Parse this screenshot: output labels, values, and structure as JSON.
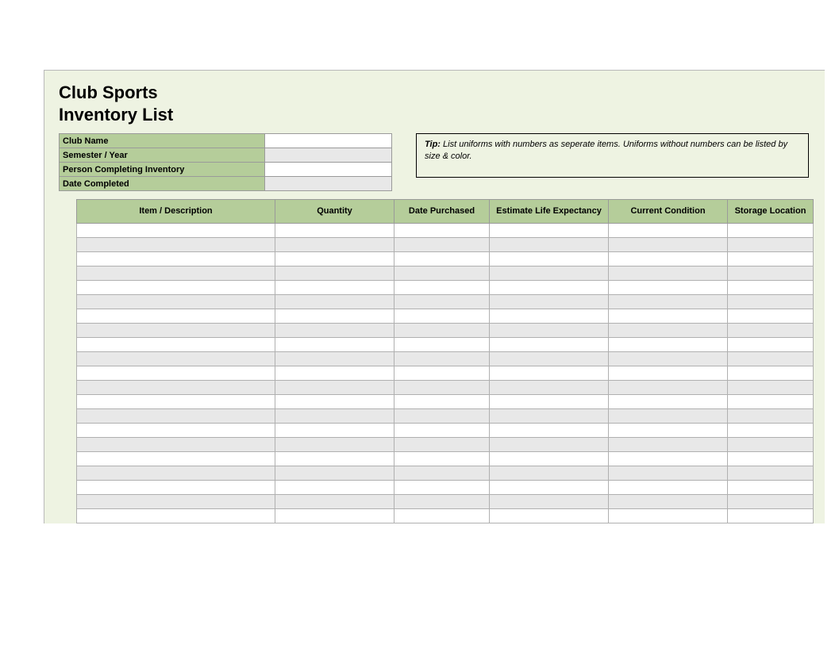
{
  "title_line1": "Club Sports",
  "title_line2": "Inventory List",
  "meta": {
    "fields": [
      {
        "label": "Club Name",
        "value": "",
        "alt": false
      },
      {
        "label": "Semester / Year",
        "value": "",
        "alt": true
      },
      {
        "label": "Person Completing Inventory",
        "value": "",
        "alt": false
      },
      {
        "label": "Date Completed",
        "value": "",
        "alt": true
      }
    ]
  },
  "tip": {
    "label": "Tip:",
    "text": " List uniforms with numbers as seperate items. Uniforms without numbers can be listed by size & color."
  },
  "inventory": {
    "headers": [
      "Item / Description",
      "Quantity",
      "Date Purchased",
      "Estimate Life Expectancy",
      "Current Condition",
      "Storage Location"
    ],
    "rows": [
      [
        "",
        "",
        "",
        "",
        "",
        ""
      ],
      [
        "",
        "",
        "",
        "",
        "",
        ""
      ],
      [
        "",
        "",
        "",
        "",
        "",
        ""
      ],
      [
        "",
        "",
        "",
        "",
        "",
        ""
      ],
      [
        "",
        "",
        "",
        "",
        "",
        ""
      ],
      [
        "",
        "",
        "",
        "",
        "",
        ""
      ],
      [
        "",
        "",
        "",
        "",
        "",
        ""
      ],
      [
        "",
        "",
        "",
        "",
        "",
        ""
      ],
      [
        "",
        "",
        "",
        "",
        "",
        ""
      ],
      [
        "",
        "",
        "",
        "",
        "",
        ""
      ],
      [
        "",
        "",
        "",
        "",
        "",
        ""
      ],
      [
        "",
        "",
        "",
        "",
        "",
        ""
      ],
      [
        "",
        "",
        "",
        "",
        "",
        ""
      ],
      [
        "",
        "",
        "",
        "",
        "",
        ""
      ],
      [
        "",
        "",
        "",
        "",
        "",
        ""
      ],
      [
        "",
        "",
        "",
        "",
        "",
        ""
      ],
      [
        "",
        "",
        "",
        "",
        "",
        ""
      ],
      [
        "",
        "",
        "",
        "",
        "",
        ""
      ],
      [
        "",
        "",
        "",
        "",
        "",
        ""
      ],
      [
        "",
        "",
        "",
        "",
        "",
        ""
      ],
      [
        "",
        "",
        "",
        "",
        "",
        ""
      ]
    ]
  }
}
